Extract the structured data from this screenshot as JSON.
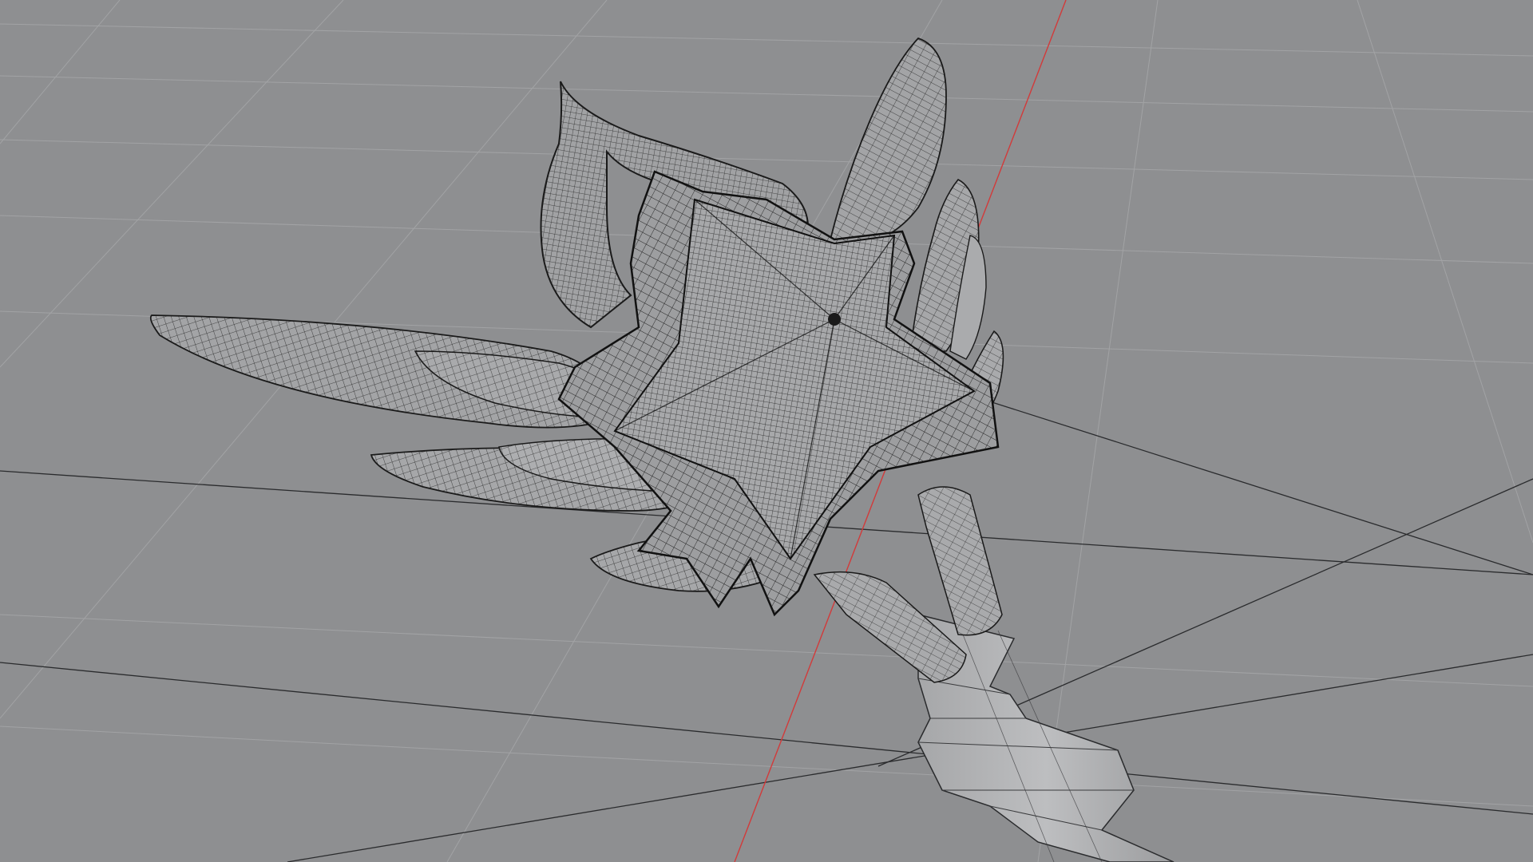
{
  "viewport": {
    "mode": "wireframe-shaded",
    "background_color": "#8e8f91",
    "grid_color": "#a3a4a6",
    "grid_major_color": "#2a2b2d",
    "axis_x_color": "#d23a3a",
    "mesh_fill_color": "#9a9b9d",
    "mesh_fill_light": "#b9babc",
    "wire_color": "#1a1a1a",
    "objects": [
      {
        "name": "star-head",
        "type": "mesh"
      },
      {
        "name": "left-wings",
        "type": "mesh"
      },
      {
        "name": "right-wings",
        "type": "mesh"
      },
      {
        "name": "crescent-frame",
        "type": "mesh"
      },
      {
        "name": "handle-cylinder",
        "type": "mesh"
      },
      {
        "name": "staff-shaft",
        "type": "mesh"
      }
    ]
  }
}
